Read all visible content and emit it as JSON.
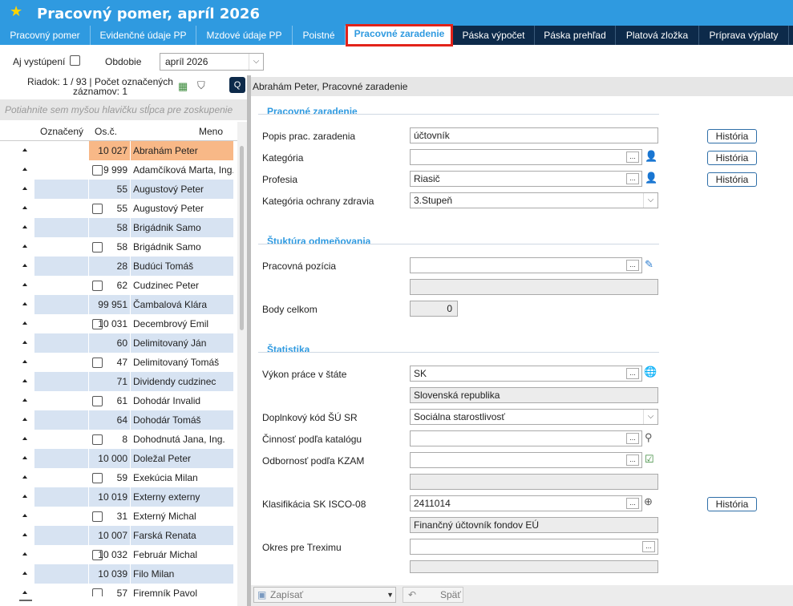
{
  "window": {
    "title": "Pracovný pomer, apríl 2026"
  },
  "tabs": [
    {
      "label": "Pracovný pomer"
    },
    {
      "label": "Evidenčné údaje PP"
    },
    {
      "label": "Mzdové údaje PP"
    },
    {
      "label": "Poistné"
    },
    {
      "label": "Pracovné zaradenie"
    },
    {
      "label": "Páska výpočet"
    },
    {
      "label": "Páska prehľad"
    },
    {
      "label": "Platová zložka"
    },
    {
      "label": "Príprava výplaty"
    }
  ],
  "toolbar": {
    "aj_vystupeni_label": "Aj vystúpení",
    "obdobie_label": "Obdobie",
    "obdobie_value": "apríl 2026"
  },
  "left": {
    "info_line1": "Riadok: 1 / 93 | Počet označených",
    "info_line2": "záznamov: 1",
    "group_hint": "Potiahnite sem myšou hlavičku stĺpca pre zoskupenie",
    "columns": {
      "oznaceny": "Označený",
      "osc": "Os.č.",
      "meno": "Meno"
    },
    "rows": [
      {
        "osc": "10 027",
        "meno": "Abrahám Peter"
      },
      {
        "osc": "9 999",
        "meno": "Adamčíková Marta, Ing."
      },
      {
        "osc": "55",
        "meno": "Augustový Peter"
      },
      {
        "osc": "55",
        "meno": "Augustový Peter"
      },
      {
        "osc": "58",
        "meno": "Brigádnik Samo"
      },
      {
        "osc": "58",
        "meno": "Brigádnik Samo"
      },
      {
        "osc": "28",
        "meno": "Budúci Tomáš"
      },
      {
        "osc": "62",
        "meno": "Cudzinec Peter"
      },
      {
        "osc": "99 951",
        "meno": "Čambalová Klára"
      },
      {
        "osc": "10 031",
        "meno": "Decembrový Emil"
      },
      {
        "osc": "60",
        "meno": "Delimitovaný Ján"
      },
      {
        "osc": "47",
        "meno": "Delimitovaný Tomáš"
      },
      {
        "osc": "71",
        "meno": "Dividendy cudzinec"
      },
      {
        "osc": "61",
        "meno": "Dohodár Invalid"
      },
      {
        "osc": "64",
        "meno": "Dohodár Tomáš"
      },
      {
        "osc": "8",
        "meno": "Dohodnutá Jana, Ing."
      },
      {
        "osc": "10 000",
        "meno": "Doležal Peter"
      },
      {
        "osc": "59",
        "meno": "Exekúcia Milan"
      },
      {
        "osc": "10 019",
        "meno": "Externy externy"
      },
      {
        "osc": "31",
        "meno": "Externý Michal"
      },
      {
        "osc": "10 007",
        "meno": "Farská Renata"
      },
      {
        "osc": "10 032",
        "meno": "Február Michal"
      },
      {
        "osc": "10 039",
        "meno": "Filo Milan"
      },
      {
        "osc": "57",
        "meno": "Firemník Pavol"
      }
    ]
  },
  "right": {
    "header": "Abrahám Peter, Pracovné zaradenie",
    "sec1": "Pracovné zaradenie",
    "sec2": "Štuktúra odmeňovania",
    "sec3": "Štatistika",
    "history_label": "História",
    "fields": {
      "popis_label": "Popis prac. zaradenia",
      "popis_value": "účtovník",
      "kategoria_label": "Kategória",
      "kategoria_value": "",
      "profesia_label": "Profesia",
      "profesia_value": "Riasič",
      "ochrana_label": "Kategória ochrany zdravia",
      "ochrana_value": "3.Stupeň",
      "pozicia_label": "Pracovná pozícia",
      "pozicia_value": "",
      "body_label": "Body celkom",
      "body_value": "0",
      "vykon_label": "Výkon práce v štáte",
      "vykon_value": "SK",
      "vykon_desc": "Slovenská republika",
      "doplnkovy_label": "Doplnkový kód ŠÚ SR",
      "doplnkovy_value": "Sociálna starostlivosť",
      "cinnost_label": "Činnosť podľa katalógu",
      "cinnost_value": "",
      "odbornost_label": "Odbornosť podľa KZAM",
      "odbornost_value": "",
      "isco_label": "Klasifikácia SK ISCO-08",
      "isco_value": "2411014",
      "isco_desc": "Finančný účtovník fondov EÚ",
      "okres_label": "Okres pre Treximu",
      "okres_value": ""
    },
    "save_label": "Zapísať",
    "back_label": "Späť",
    "dots": "..."
  }
}
